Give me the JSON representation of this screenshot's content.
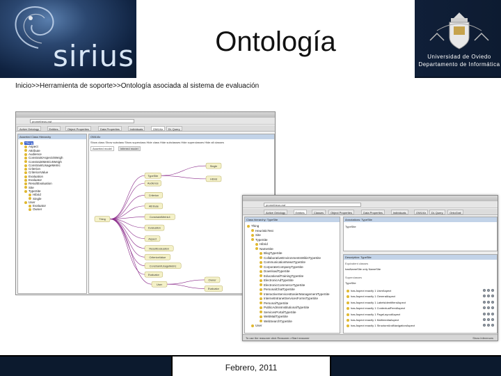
{
  "header": {
    "logo_text": "sirius",
    "title": "Ontología",
    "institution_line1": "Universidad de Oviedo",
    "institution_line2": "Departamento de Informática"
  },
  "breadcrumb": "Inicio>>Herramienta de soporte>>Ontología asociada al sistema de evaluación",
  "screenshot_left": {
    "url": "prometheus.owl",
    "tabs": [
      "Active Ontology",
      "Entities",
      "Object Properties",
      "Data Properties",
      "Individuals",
      "OWLViz",
      "DL Query"
    ],
    "active_tab": "OWLViz",
    "panel_title": "Asserted Class Hierarchy",
    "graph_panel_title": "OWLViz",
    "graph_toolbar": "Show class  Show subclass  Show superclass  Hide class  Hide subclasses  Hide superclasses  Hide all classes",
    "graph_tabs": [
      "Asserted model",
      "Inferred model"
    ],
    "tree": [
      {
        "label": "Thing",
        "depth": 0,
        "selected": true
      },
      {
        "label": "Aspect",
        "depth": 1
      },
      {
        "label": "Attribute",
        "depth": 1
      },
      {
        "label": "Audience",
        "depth": 1
      },
      {
        "label": "ConstraintAspect4Weigh",
        "depth": 1
      },
      {
        "label": "ConstraintMetric4Weigh",
        "depth": 1
      },
      {
        "label": "ConstraintUsageMetric",
        "depth": 1
      },
      {
        "label": "Criterion",
        "depth": 1
      },
      {
        "label": "CriterionValue",
        "depth": 1
      },
      {
        "label": "Evaluation",
        "depth": 1
      },
      {
        "label": "Evaluator",
        "depth": 1
      },
      {
        "label": "ResultEvaluation",
        "depth": 1
      },
      {
        "label": "Site",
        "depth": 1
      },
      {
        "label": "TypeSite",
        "depth": 1
      },
      {
        "label": "Hibrid",
        "depth": 2
      },
      {
        "label": "Single",
        "depth": 2
      },
      {
        "label": "User",
        "depth": 1
      },
      {
        "label": "Evaluator",
        "depth": 2
      },
      {
        "label": "Owner",
        "depth": 2
      }
    ],
    "graph_nodes": [
      "Thing",
      "TypeSite",
      "Single",
      "Hibrid",
      "Audience",
      "Criterion",
      "Attribute",
      "ConstraintMetric4",
      "Evaluation",
      "Aspect",
      "ResultEvaluation",
      "CriterionValue",
      "ConstraintUsageMetric",
      "Evaluator",
      "User",
      "Owner",
      "Evaluator"
    ]
  },
  "screenshot_right": {
    "url": "prometheus.owl",
    "tabs": [
      "Active Ontology",
      "Entities",
      "Classes",
      "Object Properties",
      "Data Properties",
      "Individuals",
      "OWLViz",
      "DL Query",
      "OntoGraf"
    ],
    "active_tab": "Entities",
    "left_panel_title": "Class hierarchy: TypeSite",
    "tree": [
      {
        "label": "Thing",
        "depth": 0
      },
      {
        "label": "HeuristicTest",
        "depth": 1
      },
      {
        "label": "Site",
        "depth": 1
      },
      {
        "label": "TypeSite",
        "depth": 1
      },
      {
        "label": "Hibrid",
        "depth": 2
      },
      {
        "label": "NameSite",
        "depth": 2
      },
      {
        "label": "BlogTypeSite",
        "depth": 3
      },
      {
        "label": "CollaborativeEnvironmentsWikisTypeSite",
        "depth": 3
      },
      {
        "label": "CommunicationNewsTypeSite",
        "depth": 3
      },
      {
        "label": "CorporateCompanyTypeSite",
        "depth": 3
      },
      {
        "label": "DownloadTypeSite",
        "depth": 3
      },
      {
        "label": "EducationalTrainingTypeSite",
        "depth": 3
      },
      {
        "label": "ElectronicAdTypeSite",
        "depth": 3
      },
      {
        "label": "ElectronicCommerceTypeSite",
        "depth": 3
      },
      {
        "label": "PersonalChatTypeSite",
        "depth": 3
      },
      {
        "label": "InteractiveServicesEasierManagementTypeSite",
        "depth": 3
      },
      {
        "label": "InternetIntranetServicesFormsTypeSite",
        "depth": 3
      },
      {
        "label": "PersonalTypeSite",
        "depth": 3
      },
      {
        "label": "PublicAdminInstitutionalTypeSite",
        "depth": 3
      },
      {
        "label": "ServicesPortalTypeSite",
        "depth": 3
      },
      {
        "label": "WebMailTypeSite",
        "depth": 3
      },
      {
        "label": "WebSearchTypeSite",
        "depth": 3
      },
      {
        "label": "User",
        "depth": 1
      }
    ],
    "annotations_title": "Annotations: TypeSite",
    "annotation_value": "TypeSite",
    "description_title": "Description: TypeSite",
    "equivalent_label": "Equivalent classes",
    "equivalent_value": "hasNameSite only NameSite",
    "superclasses_label": "Superclasses",
    "superclass_value": "TypeSite",
    "restrictions": [
      "has Aspect exactly 1 UserAspect",
      "has Aspect exactly 1 GeneralAspect",
      "has Aspect exactly 1 LabelsIdentifiersAspect",
      "has Aspect exactly 1 ContextualFeedAspect",
      "has Aspect exactly 1 PageLayoutAspect",
      "has Aspect exactly 1 MultimediaAspect",
      "has Aspect exactly 1 StructureAndNavigationAspect"
    ],
    "status": "To use the reasoner click Reasoner->Start reasoner",
    "show_inferences": "Show Inferences"
  },
  "footer": {
    "date": "Febrero, 2011"
  },
  "colors": {
    "header_bg": "#0c1a2e",
    "class_dot": "#e0b830",
    "graph_edge": "#8a2a8a",
    "selection": "#2f58c8"
  }
}
